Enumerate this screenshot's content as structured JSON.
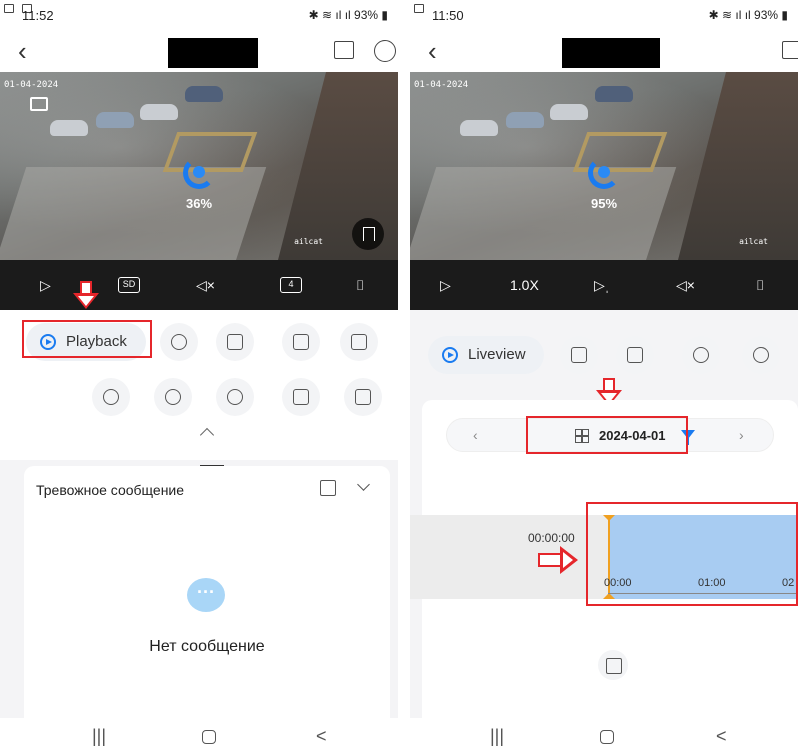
{
  "left": {
    "status": {
      "time": "11:52",
      "battery": "93%"
    },
    "video": {
      "cam_stamp": "01-04-2024",
      "watermark": "ailcat",
      "percent": "36%"
    },
    "controls": {
      "quality": "SD",
      "split": "4"
    },
    "playback_label": "Playback",
    "alarm": {
      "title": "Тревожное сообщение",
      "empty": "Нет сообщение"
    }
  },
  "right": {
    "status": {
      "time": "11:50",
      "battery": "93%"
    },
    "video": {
      "cam_stamp": "01-04-2024",
      "watermark": "ailcat",
      "percent": "95%"
    },
    "controls": {
      "speed": "1.0X"
    },
    "liveview_label": "Liveview",
    "date": "2024-04-01",
    "timeline": {
      "current": "00:00:00",
      "ticks": [
        "00:00",
        "01:00",
        "02"
      ]
    }
  },
  "sysnav": {
    "recents": "|||",
    "back": "<"
  },
  "colors": {
    "accent": "#1a7bf0",
    "annotation": "#e5262b",
    "record": "#a8ccf2"
  }
}
